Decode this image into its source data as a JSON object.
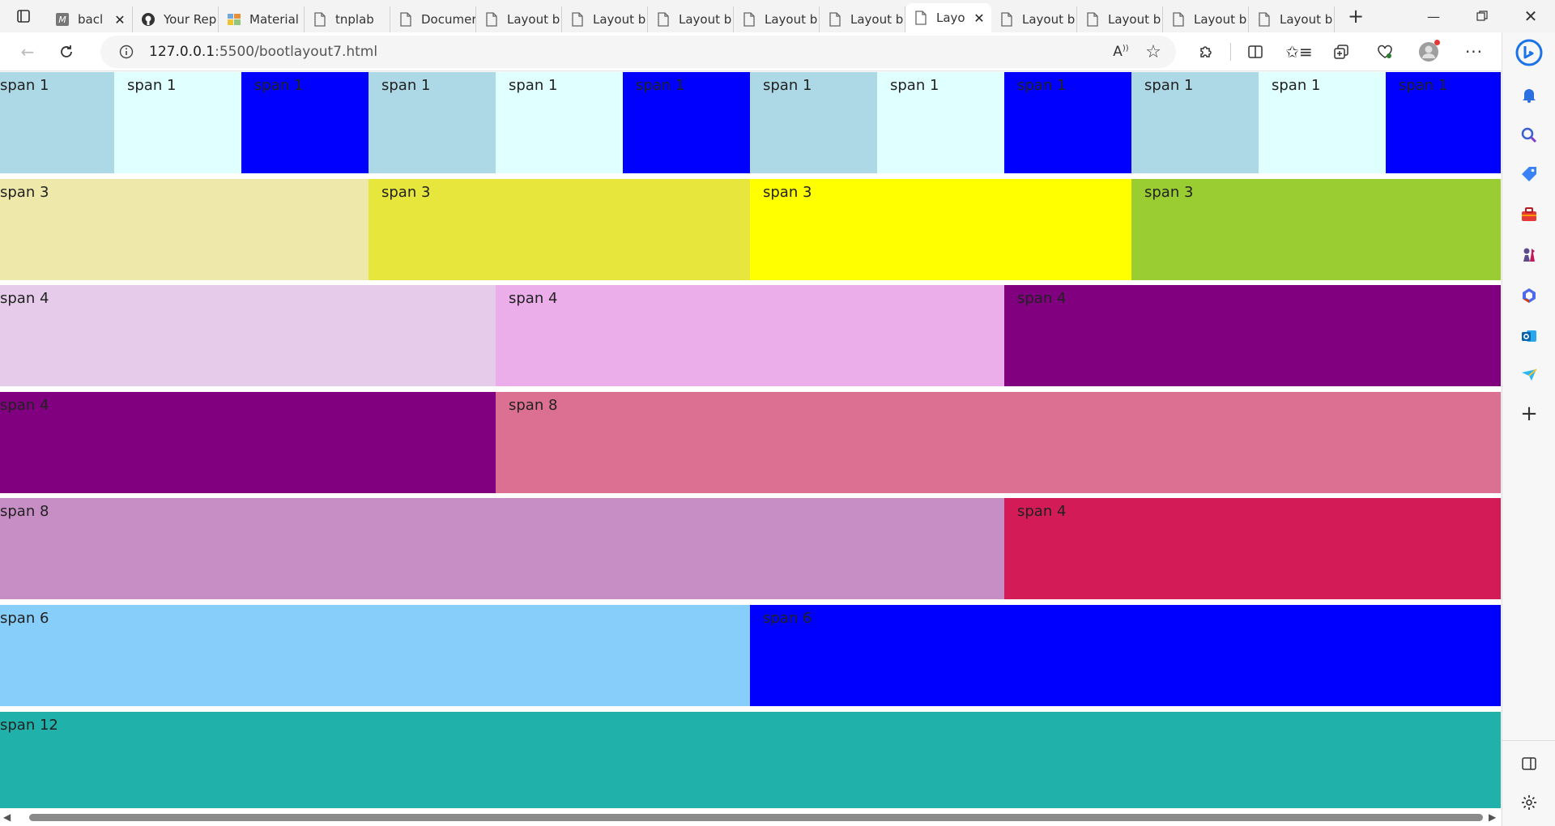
{
  "tabs": [
    {
      "title": "bacl",
      "favicon": "m-logo-icon",
      "active": false,
      "closable": true
    },
    {
      "title": "Your Rep",
      "favicon": "github-icon",
      "active": false,
      "closable": false
    },
    {
      "title": "Material",
      "favicon": "material-icon",
      "active": false,
      "closable": false
    },
    {
      "title": "tnplab",
      "favicon": "page-icon",
      "active": false,
      "closable": false
    },
    {
      "title": "Documer",
      "favicon": "page-icon",
      "active": false,
      "closable": false
    },
    {
      "title": "Layout b",
      "favicon": "page-icon",
      "active": false,
      "closable": false
    },
    {
      "title": "Layout b",
      "favicon": "page-icon",
      "active": false,
      "closable": false
    },
    {
      "title": "Layout b",
      "favicon": "page-icon",
      "active": false,
      "closable": false
    },
    {
      "title": "Layout b",
      "favicon": "page-icon",
      "active": false,
      "closable": false
    },
    {
      "title": "Layout b",
      "favicon": "page-icon",
      "active": false,
      "closable": false
    },
    {
      "title": "Layo",
      "favicon": "page-icon",
      "active": true,
      "closable": true
    },
    {
      "title": "Layout b",
      "favicon": "page-icon",
      "active": false,
      "closable": false
    },
    {
      "title": "Layout b",
      "favicon": "page-icon",
      "active": false,
      "closable": false
    },
    {
      "title": "Layout b",
      "favicon": "page-icon",
      "active": false,
      "closable": false
    },
    {
      "title": "Layout b",
      "favicon": "page-icon",
      "active": false,
      "closable": false
    }
  ],
  "address": {
    "host": "127.0.0.1",
    "rest": ":5500/bootlayout7.html"
  },
  "grid": {
    "rows": [
      [
        {
          "label": "span 1",
          "span": 1,
          "color": "#add8e6"
        },
        {
          "label": "span 1",
          "span": 1,
          "color": "#e0ffff"
        },
        {
          "label": "span 1",
          "span": 1,
          "color": "#0000ff"
        },
        {
          "label": "span 1",
          "span": 1,
          "color": "#add8e6"
        },
        {
          "label": "span 1",
          "span": 1,
          "color": "#e0ffff"
        },
        {
          "label": "span 1",
          "span": 1,
          "color": "#0000ff"
        },
        {
          "label": "span 1",
          "span": 1,
          "color": "#add8e6"
        },
        {
          "label": "span 1",
          "span": 1,
          "color": "#e0ffff"
        },
        {
          "label": "span 1",
          "span": 1,
          "color": "#0000ff"
        },
        {
          "label": "span 1",
          "span": 1,
          "color": "#add8e6"
        },
        {
          "label": "span 1",
          "span": 1,
          "color": "#e0ffff"
        },
        {
          "label": "span 1",
          "span": 1,
          "color": "#0000ff"
        }
      ],
      [
        {
          "label": "span 3",
          "span": 3,
          "color": "#eee8aa"
        },
        {
          "label": "span 3",
          "span": 3,
          "color": "#e6e63c"
        },
        {
          "label": "span 3",
          "span": 3,
          "color": "#ffff00"
        },
        {
          "label": "span 3",
          "span": 3,
          "color": "#9acd32"
        }
      ],
      [
        {
          "label": "span 4",
          "span": 4,
          "color": "#e6ccea"
        },
        {
          "label": "span 4",
          "span": 4,
          "color": "#ebaeea"
        },
        {
          "label": "span 4",
          "span": 4,
          "color": "#800080"
        }
      ],
      [
        {
          "label": "span 4",
          "span": 4,
          "color": "#800080"
        },
        {
          "label": "span 8",
          "span": 8,
          "color": "#db7093"
        }
      ],
      [
        {
          "label": "span 8",
          "span": 8,
          "color": "#c78dc5"
        },
        {
          "label": "span 4",
          "span": 4,
          "color": "#d21b57"
        }
      ],
      [
        {
          "label": "span 6",
          "span": 6,
          "color": "#87cefa"
        },
        {
          "label": "span 6",
          "span": 6,
          "color": "#0000ff"
        }
      ],
      [
        {
          "label": "span 12",
          "span": 12,
          "color": "#20b2aa"
        }
      ]
    ]
  },
  "colors": {
    "bing": "#1a73e8",
    "bell": "#2b6fe0",
    "profile-dot": "#e53935"
  }
}
